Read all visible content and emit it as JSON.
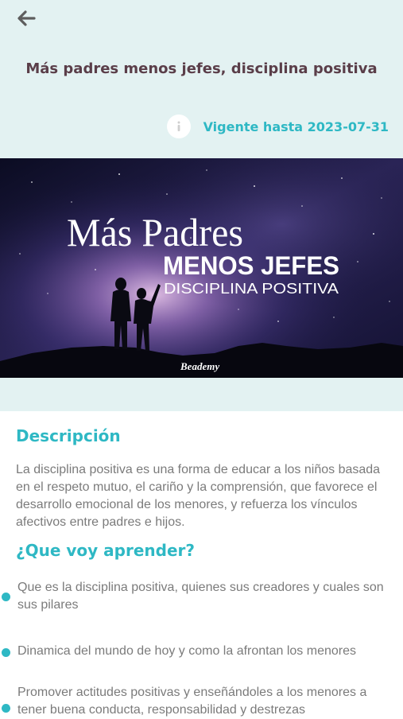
{
  "course": {
    "title": "Más padres menos jefes, disciplina positiva",
    "valid_until": "Vigente hasta 2023-07-31"
  },
  "banner": {
    "line1": "Más Padres",
    "line2": "MENOS JEFES",
    "line3": "DISCIPLINA POSITIVA",
    "logo": "Beademy"
  },
  "description": {
    "heading": "Descripción",
    "text": "La disciplina positiva es una forma de educar a los niños basada en el respeto mutuo, el cariño y la comprensión, que favorece el desarrollo emocional de los menores, y refuerza los vínculos afectivos entre padres e hijos."
  },
  "learn": {
    "heading": "¿Que voy aprender?",
    "items": [
      "Que es la disciplina positiva, quienes sus creadores y cuales son sus pilares",
      "Dinamica del mundo de hoy y como la afrontan los menores",
      "Promover actitudes positivas y enseñándoles a los menores a tener buena conducta, responsabilidad y destrezas"
    ]
  },
  "colors": {
    "accent": "#2eb8c4",
    "header_bg": "#e3f2f2",
    "title": "#5a3e49",
    "body_text": "#7b7b7b"
  },
  "icons": {
    "back": "arrow-left-icon",
    "info": "info-icon"
  }
}
